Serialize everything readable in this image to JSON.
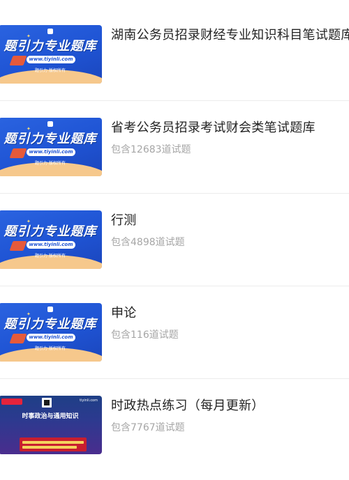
{
  "thumbnail": {
    "brand_text": "题引力专业题库",
    "url_text": "www.tiyinli.com",
    "tagline": "题引力 版权所有"
  },
  "items": [
    {
      "title": "湖南公务员招录财经专业知识科目笔试题库",
      "count": ""
    },
    {
      "title": "省考公务员招录考试财会类笔试题库",
      "count": "包含12683道试题"
    },
    {
      "title": "行测",
      "count": "包含4898道试题"
    },
    {
      "title": "申论",
      "count": "包含116道试题"
    },
    {
      "title": "时政热点练习（每月更新）",
      "count": "包含7767道试题"
    }
  ],
  "news_thumbnail": {
    "headline": "时事政治与通用知识",
    "site": "tiyinli.com"
  },
  "colors": {
    "brand_blue": "#1f54d4",
    "accent_orange": "#f6c88c",
    "title_text": "#222222",
    "count_text": "#a6a6a6"
  }
}
